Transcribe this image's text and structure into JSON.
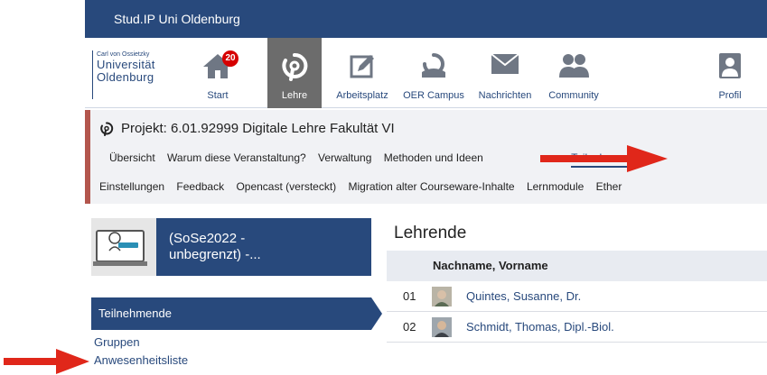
{
  "topbar": {
    "brand": "Stud.IP Uni Oldenburg",
    "color": "#28497c"
  },
  "logo": {
    "line1": "Carl von Ossietzky",
    "line2": "Universität",
    "line3": "Oldenburg"
  },
  "nav": {
    "items": [
      {
        "label": "Start",
        "icon": "home-icon",
        "badge": "20"
      },
      {
        "label": "Lehre",
        "icon": "lehre-icon",
        "active": true
      },
      {
        "label": "Arbeitsplatz",
        "icon": "workplace-icon"
      },
      {
        "label": "OER Campus",
        "icon": "oer-icon"
      },
      {
        "label": "Nachrichten",
        "icon": "mail-icon"
      },
      {
        "label": "Community",
        "icon": "community-icon"
      },
      {
        "label": "Profil",
        "icon": "profile-icon"
      }
    ]
  },
  "context": {
    "title": "Projekt: 6.01.92999 Digitale Lehre Fakultät VI",
    "tabs_row1": [
      "Übersicht",
      "Warum diese Veranstaltung?",
      "Verwaltung",
      "Methoden und Ideen",
      "Teilnehmende"
    ],
    "tabs_row2": [
      "Einstellungen",
      "Feedback",
      "Opencast (versteckt)",
      "Migration alter Courseware-Inhalte",
      "Lernmodule",
      "Ether"
    ],
    "active_tab": "Teilnehmende"
  },
  "course": {
    "title_line1": "(SoSe2022 -",
    "title_line2": "unbegrenzt) -..."
  },
  "sidebar": {
    "active": "Teilnehmende",
    "links": [
      "Gruppen",
      "Anwesenheitsliste"
    ]
  },
  "main": {
    "heading": "Lehrende",
    "column": "Nachname, Vorname",
    "rows": [
      {
        "num": "01",
        "name": "Quintes, Susanne, Dr."
      },
      {
        "num": "02",
        "name": "Schmidt, Thomas, Dipl.-Biol."
      }
    ]
  },
  "colors": {
    "accent": "#28497c",
    "arrow": "#e0271a",
    "badge": "#d60000"
  }
}
